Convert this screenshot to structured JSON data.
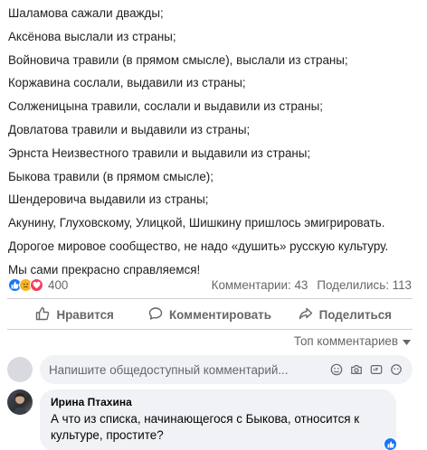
{
  "post": {
    "lines": [
      "Шаламова сажали дважды;",
      "Аксёнова выслали из страны;",
      "Войновича травили (в прямом смысле), выслали из страны;",
      "Коржавина сослали, выдавили из страны;",
      "Солженицына травили, сослали и выдавили из страны;",
      "Довлатова травили и выдавили из страны;",
      "Эрнста Неизвестного травили и выдавили из страны;",
      "Быкова травили (в прямом смысле);",
      "Шендеровича выдавили из страны;",
      "Акунину, Глуховскому, Улицкой, Шишкину пришлось эмигрировать.",
      "Дорогое мировое сообщество, не надо «душить» русскую культуру.",
      "Мы сами прекрасно справляемся!"
    ]
  },
  "stats": {
    "reactions": [
      "like",
      "sad",
      "love"
    ],
    "reaction_count": "400",
    "comments": "Комментарии: 43",
    "shares": "Поделились: 113"
  },
  "actions": {
    "like": "Нравится",
    "comment": "Комментировать",
    "share": "Поделиться"
  },
  "comments_sort": {
    "label": "Топ комментариев"
  },
  "composer": {
    "placeholder": "Напишите общедоступный комментарий...",
    "icons": [
      "emoji-icon",
      "camera-icon",
      "gif-icon",
      "sticker-icon"
    ]
  },
  "comment": {
    "author": "Ирина Птахина",
    "text": "А что из списка, начинающегося с Быкова, относится к культуре, простите?",
    "reaction": "like"
  },
  "colors": {
    "primary": "#1877f2",
    "secondary_text": "#65676b",
    "bubble": "#f0f2f5",
    "love": "#f33e58",
    "sad": "#f7b125"
  }
}
